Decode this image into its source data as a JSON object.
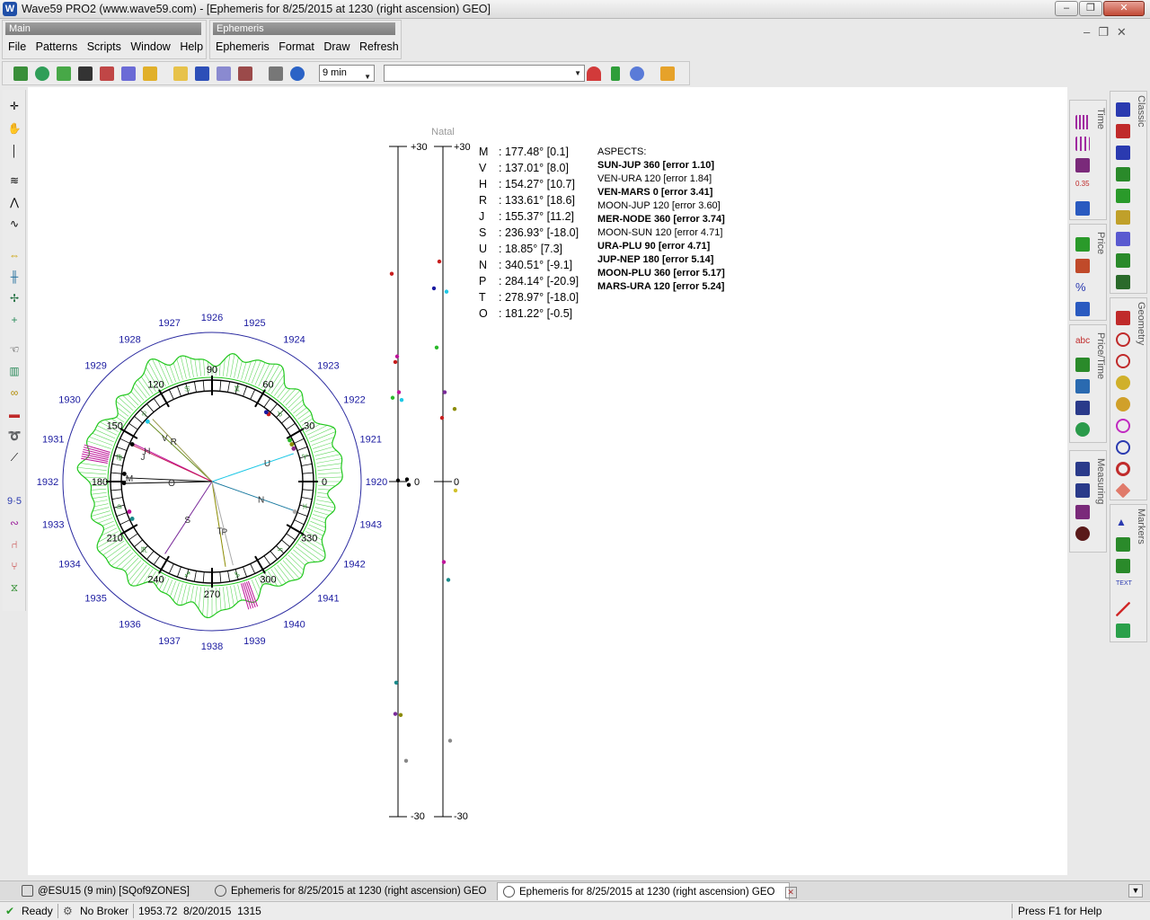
{
  "window": {
    "title": "Wave59 PRO2 (www.wave59.com) - [Ephemeris for 8/25/2015 at 1230 (right ascension) GEO]",
    "icon": "wave59-logo-icon",
    "minimize": "–",
    "maximize": "❐",
    "close": "✕"
  },
  "menu_panels": {
    "main": {
      "title": "Main",
      "items": [
        "File",
        "Patterns",
        "Scripts",
        "Window",
        "Help"
      ]
    },
    "ephemeris": {
      "title": "Ephemeris",
      "items": [
        "Ephemeris",
        "Format",
        "Draw",
        "Refresh"
      ]
    }
  },
  "mdi": {
    "minimize": "–",
    "restore": "❐",
    "close": "✕"
  },
  "toolbar": {
    "interval": "9 min",
    "symbol": "",
    "icons": [
      "new-chart-icon",
      "search-icon",
      "add-icon",
      "film-icon",
      "rocket-icon",
      "wave-icon",
      "warning-icon",
      "folder-icon",
      "save-icon",
      "save-as-icon",
      "chart-icon",
      "print-icon",
      "refresh-icon",
      "magnet-icon",
      "updown-arrow-icon",
      "eye-icon",
      "layout-icon"
    ]
  },
  "left_tools": [
    "crosshair-icon",
    "hand-icon",
    "cursor-line-icon",
    "wave-count-icon",
    "pattern-icon",
    "curve-icon",
    "h-measure-icon",
    "v-bars-icon",
    "split-icon",
    "split-small-icon",
    "pointer-hand-icon",
    "trash-icon",
    "link-icon",
    "car-icon",
    "lasso-icon",
    "ruler-icon",
    "nine-five-icon",
    "sine-icon",
    "tree-one-icon",
    "tree-two-icon",
    "zigzag-icon"
  ],
  "right_panels": {
    "tabs": [
      "Time",
      "Price",
      "Price/Time",
      "Measuring",
      "Classic",
      "Geometry",
      "Markers"
    ]
  },
  "wheel": {
    "years": [
      "1926",
      "1925",
      "1924",
      "1923",
      "1922",
      "1921",
      "1920",
      "1943",
      "1942",
      "1941",
      "1940",
      "1939",
      "1938",
      "1937",
      "1936",
      "1935",
      "1934",
      "1933",
      "1932",
      "1931",
      "1930",
      "1929",
      "1928",
      "1927"
    ],
    "degrees": [
      "90",
      "60",
      "30",
      "0",
      "330",
      "300",
      "270",
      "240",
      "210",
      "180",
      "150",
      "120"
    ],
    "planet_labels": [
      "V",
      "R",
      "H",
      "J",
      "M",
      "O",
      "U",
      "N",
      "S",
      "T",
      "P"
    ]
  },
  "bars": {
    "header": "Natal",
    "top_left": "+30",
    "top_right": "+30",
    "zero_left": "0",
    "zero_right": "0",
    "bottom_left": "-30",
    "bottom_right": "-30"
  },
  "planets": [
    {
      "sym": "M",
      "val": ": 177.48° [0.1]"
    },
    {
      "sym": "V",
      "val": ": 137.01° [8.0]"
    },
    {
      "sym": "H",
      "val": ": 154.27° [10.7]"
    },
    {
      "sym": "R",
      "val": ": 133.61° [18.6]"
    },
    {
      "sym": "J",
      "val": ": 155.37° [11.2]"
    },
    {
      "sym": "S",
      "val": ": 236.93° [-18.0]"
    },
    {
      "sym": "U",
      "val": ": 18.85° [7.3]"
    },
    {
      "sym": "N",
      "val": ": 340.51° [-9.1]"
    },
    {
      "sym": "P",
      "val": ": 284.14° [-20.9]"
    },
    {
      "sym": "T",
      "val": ": 278.97° [-18.0]"
    },
    {
      "sym": "O",
      "val": ": 181.22° [-0.5]"
    }
  ],
  "aspects": {
    "title": "ASPECTS:",
    "items": [
      {
        "text": "SUN-JUP 360 [error 1.10]",
        "bold": true
      },
      {
        "text": "VEN-URA 120 [error 1.84]",
        "bold": false
      },
      {
        "text": "VEN-MARS 0 [error 3.41]",
        "bold": true
      },
      {
        "text": "MOON-JUP 120 [error 3.60]",
        "bold": false
      },
      {
        "text": "MER-NODE 360 [error 3.74]",
        "bold": true
      },
      {
        "text": "MOON-SUN 120 [error 4.71]",
        "bold": false
      },
      {
        "text": "URA-PLU 90 [error 4.71]",
        "bold": true
      },
      {
        "text": "JUP-NEP 180 [error 5.14]",
        "bold": true
      },
      {
        "text": "MOON-PLU 360 [error 5.17]",
        "bold": true
      },
      {
        "text": "MARS-URA 120 [error 5.24]",
        "bold": true
      }
    ]
  },
  "doc_tabs": [
    {
      "label": "@ESU15 (9 min) [SQof9ZONES]",
      "icon": "chart-icon"
    },
    {
      "label": "Ephemeris for 8/25/2015 at 1230 (right ascension) GEO",
      "icon": "ephemeris-icon"
    },
    {
      "label": "Ephemeris for 8/25/2015 at 1230 (right ascension) GEO",
      "icon": "ephemeris-icon"
    }
  ],
  "status": {
    "ready": "Ready",
    "broker": "No Broker",
    "price_time": "1953.72  8/20/2015  1315",
    "help": "Press F1 for Help"
  },
  "colors": {
    "wheel_green": "#22c81e",
    "year_blue": "#1a1aa0",
    "sign_green": "#2a8a2a",
    "highlight_magenta": "#c0139b"
  }
}
